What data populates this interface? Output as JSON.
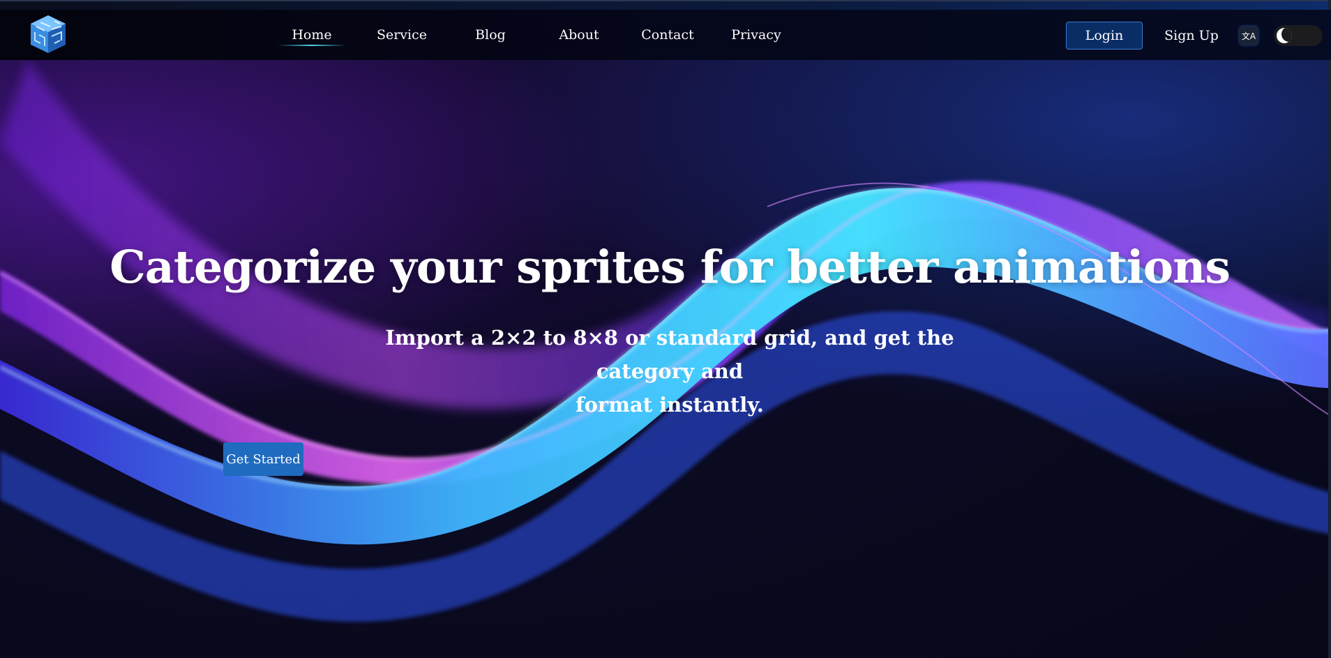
{
  "nav": {
    "logo_icon": "cube-logo-icon",
    "items": [
      {
        "label": "Home",
        "active": true
      },
      {
        "label": "Service",
        "active": false
      },
      {
        "label": "Blog",
        "active": false
      },
      {
        "label": "About",
        "active": false
      },
      {
        "label": "Contact",
        "active": false
      },
      {
        "label": "Privacy",
        "active": false
      }
    ],
    "login_label": "Login",
    "signup_label": "Sign Up",
    "translate_icon": "translate-icon",
    "theme_toggle_icon": "moon-icon"
  },
  "hero": {
    "title": "Categorize your sprites for better animations",
    "subtitle_line1": "Import a 2×2 to 8×8 or standard grid, and get the category and",
    "subtitle_line2": "format instantly.",
    "cta_label": "Get Started"
  },
  "colors": {
    "accent": "#1f6bbf",
    "login_bg": "#0b2d66",
    "wave_cyan": "#3de8ff",
    "wave_purple": "#8a2be2"
  }
}
